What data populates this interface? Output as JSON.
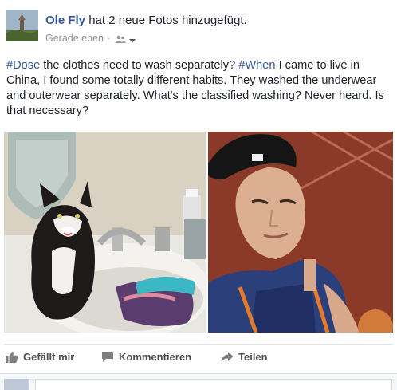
{
  "post": {
    "author": "Ole Fly",
    "action_text": "hat 2 neue Fotos",
    "action_suffix": "hinzugefügt.",
    "timestamp": "Gerade eben",
    "separator": "·",
    "audience_icon": "friends-icon",
    "message": {
      "hashtag1": "#Dose",
      "text1": " the clothes need to wash separately?  ",
      "hashtag2": "#When",
      "text2": " I came to live in China, I found some totally different habits. They washed the underwear and outerwear separately. What's the classified washing?  Never heard. Is that necessary?"
    }
  },
  "actions": {
    "like_label": "Gefällt mir",
    "comment_label": "Kommentieren",
    "share_label": "Teilen"
  },
  "colors": {
    "link": "#365899",
    "text": "#1d2129",
    "meta": "#90949c",
    "action": "#4b4f56"
  }
}
